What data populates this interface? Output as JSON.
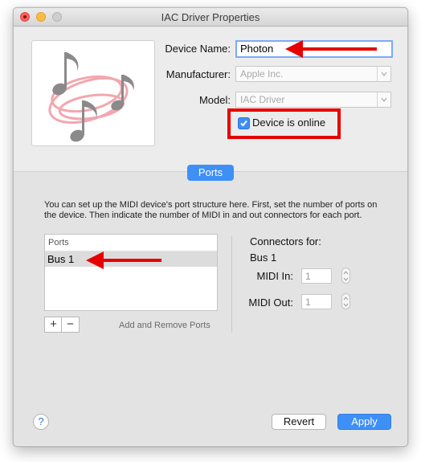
{
  "window": {
    "title": "IAC Driver Properties"
  },
  "device": {
    "name_label": "Device Name:",
    "name_value": "Photon",
    "manufacturer_label": "Manufacturer:",
    "manufacturer_value": "Apple Inc.",
    "model_label": "Model:",
    "model_value": "IAC Driver",
    "online_label": "Device is online",
    "online_checked": true
  },
  "tab": {
    "label": "Ports"
  },
  "description": "You can set up the MIDI device's port structure here. First, set the number of ports on the device. Then indicate the number of MIDI in and out connectors for each port.",
  "ports": {
    "header": "Ports",
    "rows": [
      "Bus 1"
    ],
    "add_remove_label": "Add and Remove Ports"
  },
  "connectors": {
    "title": "Connectors for:",
    "bus": "Bus 1",
    "midi_in_label": "MIDI In:",
    "midi_in_value": "1",
    "midi_out_label": "MIDI Out:",
    "midi_out_value": "1"
  },
  "buttons": {
    "help": "?",
    "revert": "Revert",
    "apply": "Apply"
  },
  "icons": {
    "device_icon": "music-notes-icon",
    "popup_arrow": "chevron-updown-icon",
    "annotation_arrow": "red-arrow-icon"
  },
  "colors": {
    "accent": "#3e8ff6",
    "annotation": "#e60000",
    "close": "#fc605c",
    "minimize": "#fdbc40"
  }
}
